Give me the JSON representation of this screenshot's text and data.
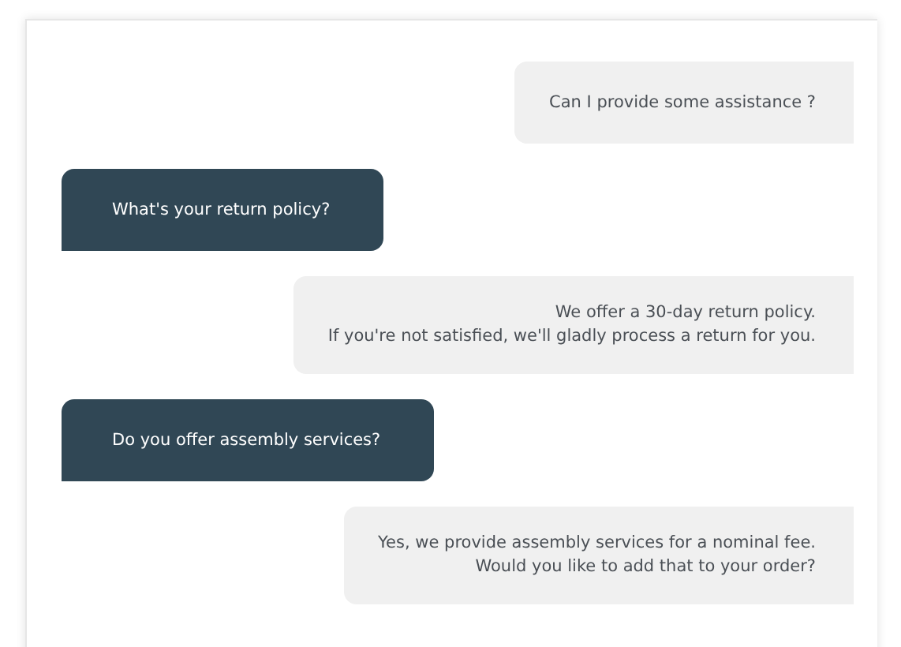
{
  "messages": [
    {
      "kind": "agent",
      "lines": [
        "Can I provide some assistance ?"
      ]
    },
    {
      "kind": "user",
      "lines": [
        "What's your return policy?"
      ]
    },
    {
      "kind": "agent",
      "lines": [
        "We offer a 30-day return policy.",
        "If you're not satisfied, we'll gladly process a return for you."
      ]
    },
    {
      "kind": "user",
      "lines": [
        "Do you offer assembly services?"
      ]
    },
    {
      "kind": "agent",
      "lines": [
        "Yes, we provide assembly services for a nominal fee.",
        "Would you like to add that to your order?"
      ]
    }
  ]
}
